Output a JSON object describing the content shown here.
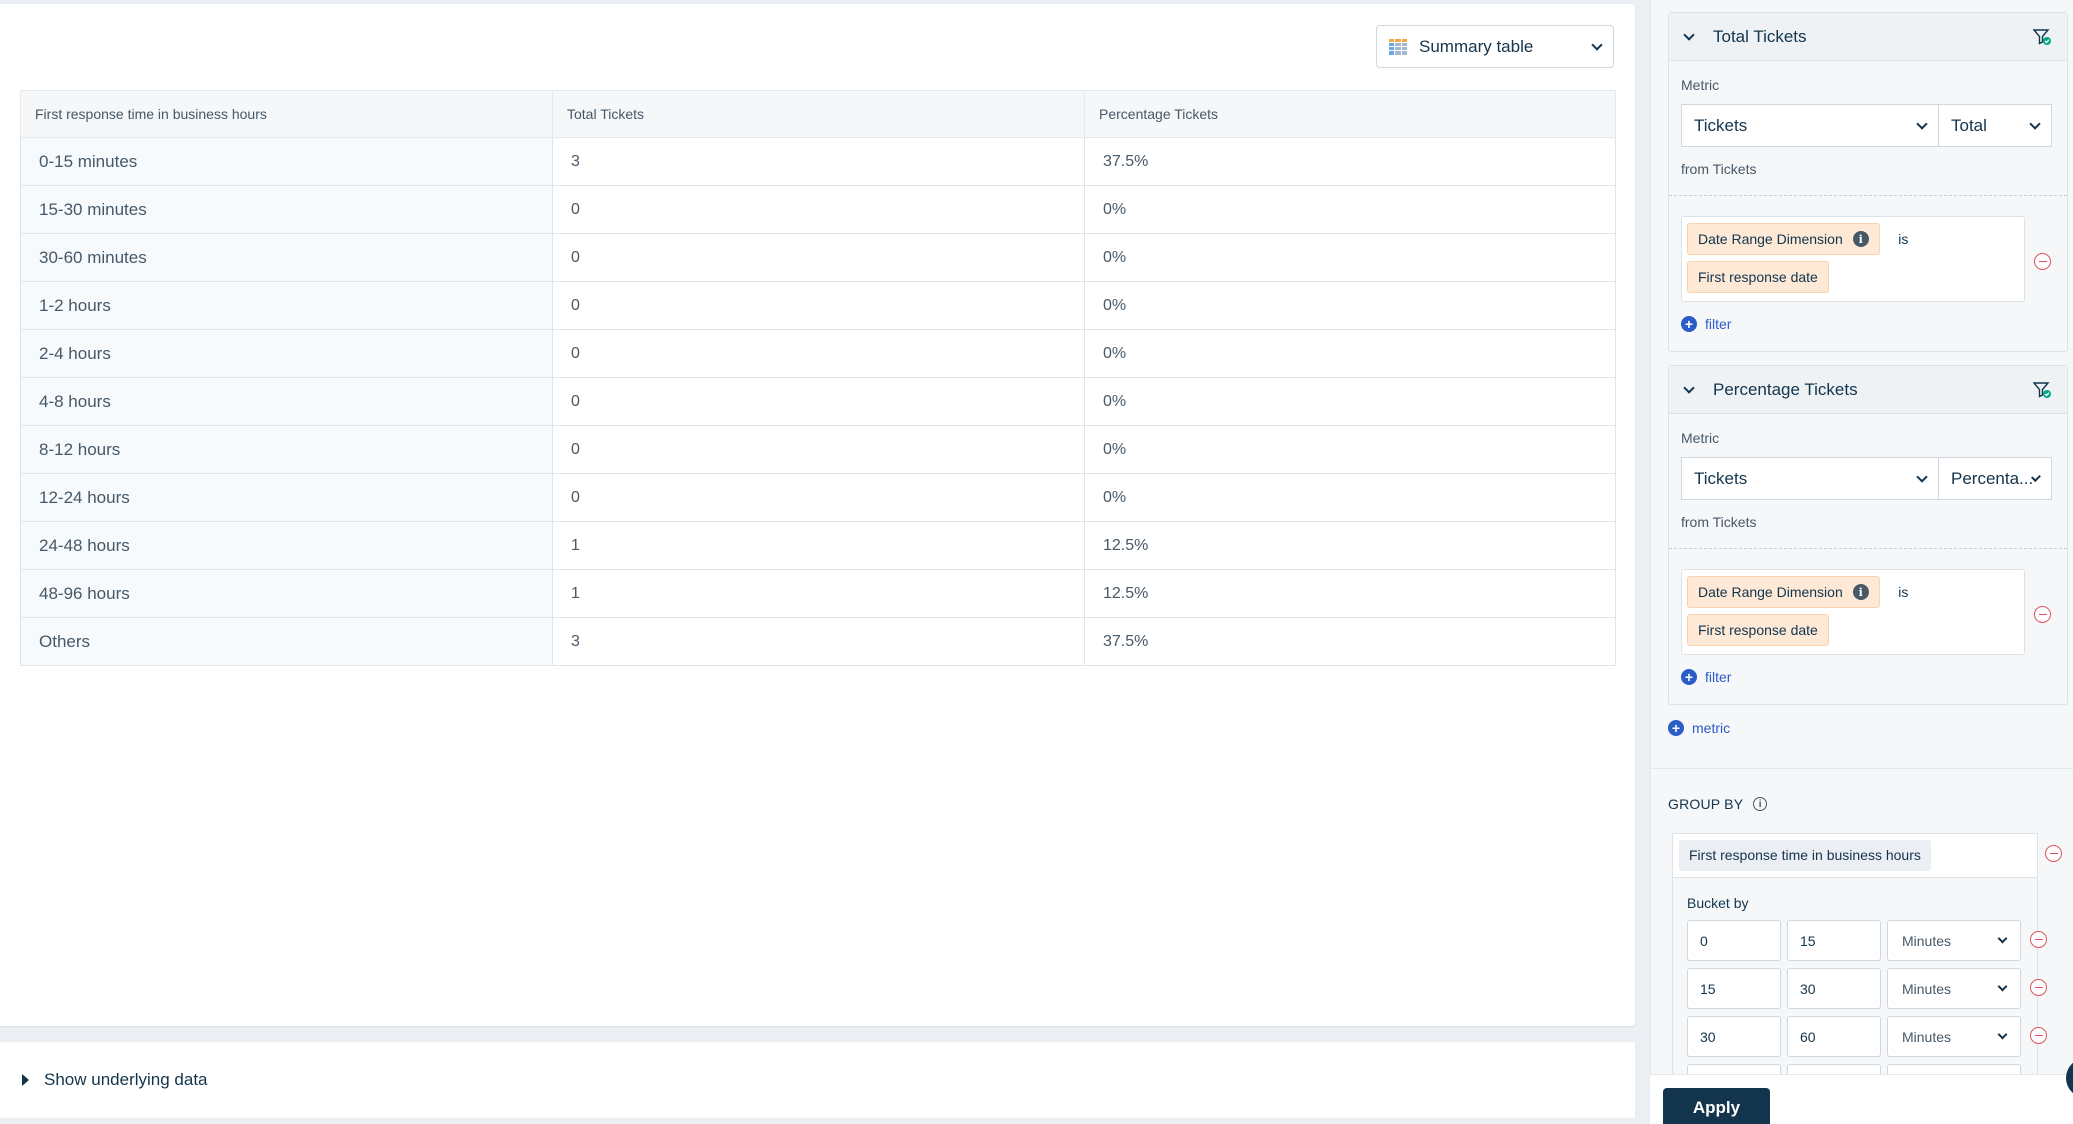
{
  "view_selector": {
    "label": "Summary table"
  },
  "table": {
    "headers": [
      "First response time in business hours",
      "Total Tickets",
      "Percentage Tickets"
    ],
    "rows": [
      [
        "0-15 minutes",
        "3",
        "37.5%"
      ],
      [
        "15-30 minutes",
        "0",
        "0%"
      ],
      [
        "30-60 minutes",
        "0",
        "0%"
      ],
      [
        "1-2 hours",
        "0",
        "0%"
      ],
      [
        "2-4 hours",
        "0",
        "0%"
      ],
      [
        "4-8 hours",
        "0",
        "0%"
      ],
      [
        "8-12 hours",
        "0",
        "0%"
      ],
      [
        "12-24 hours",
        "0",
        "0%"
      ],
      [
        "24-48 hours",
        "1",
        "12.5%"
      ],
      [
        "48-96 hours",
        "1",
        "12.5%"
      ],
      [
        "Others",
        "3",
        "37.5%"
      ]
    ]
  },
  "underlying": {
    "label": "Show underlying data"
  },
  "metrics": [
    {
      "title": "Total Tickets",
      "metric_label": "Metric",
      "metric_value": "Tickets",
      "aggregation": "Total",
      "from": "from Tickets",
      "condition": {
        "field": "Date Range Dimension",
        "operator": "is",
        "value": "First response date"
      },
      "add_filter": "filter"
    },
    {
      "title": "Percentage Tickets",
      "metric_label": "Metric",
      "metric_value": "Tickets",
      "aggregation": "Percenta...",
      "from": "from Tickets",
      "condition": {
        "field": "Date Range Dimension",
        "operator": "is",
        "value": "First response date"
      },
      "add_filter": "filter"
    }
  ],
  "add_metric": "metric",
  "group_by": {
    "label": "GROUP BY",
    "field": "First response time in business hours",
    "bucket_label": "Bucket by",
    "buckets": [
      {
        "from": "0",
        "to": "15",
        "unit": "Minutes"
      },
      {
        "from": "15",
        "to": "30",
        "unit": "Minutes"
      },
      {
        "from": "30",
        "to": "60",
        "unit": "Minutes"
      }
    ]
  },
  "apply_label": "Apply",
  "colors": {
    "primary": "#12344d",
    "link": "#2c5cc5",
    "danger": "#e0525d",
    "chip": "#fde9d6"
  },
  "icons": [
    "table-icon",
    "chevron-down-icon",
    "filter-check-icon",
    "info-icon",
    "remove-icon",
    "plus-icon",
    "caret-right-icon"
  ]
}
